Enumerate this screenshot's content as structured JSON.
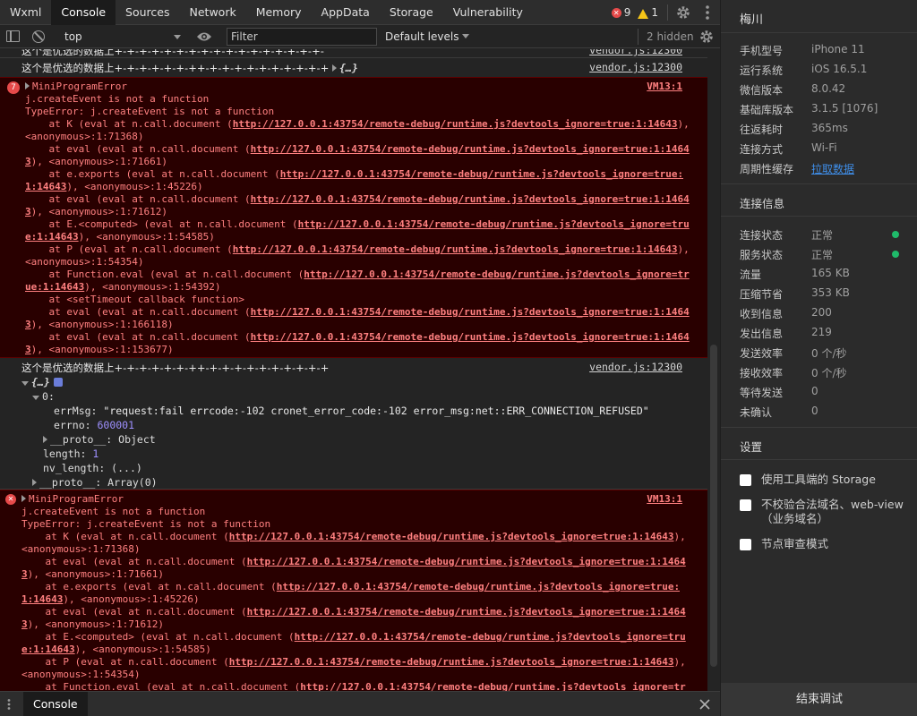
{
  "tabs": [
    {
      "label": "Wxml",
      "active": false
    },
    {
      "label": "Console",
      "active": true
    },
    {
      "label": "Sources",
      "active": false
    },
    {
      "label": "Network",
      "active": false
    },
    {
      "label": "Memory",
      "active": false
    },
    {
      "label": "AppData",
      "active": false
    },
    {
      "label": "Storage",
      "active": false
    },
    {
      "label": "Vulnerability",
      "active": false
    }
  ],
  "counts": {
    "errors": "9",
    "warnings": "1"
  },
  "toolbar": {
    "context": "top",
    "filter_placeholder": "Filter",
    "levels": "Default levels",
    "hidden": "2 hidden"
  },
  "logs": {
    "partial_top": "这个是优选的数据上+-+-+-+-+-+-+-+-+-+-+-+-+-+-+-+-+-",
    "partial_top_src": "vendor.js:12300",
    "row1": {
      "msg": "这个是优选的数据上+-+-+-+-+-+-++-+-+-+-+-+-+-+-+-+-+",
      "preview": "{…}",
      "src": "vendor.js:12300"
    },
    "err1": {
      "count": "7",
      "title": "MiniProgramError",
      "src": "VM13:1",
      "message": "j.createEvent is not a function",
      "type_line": "TypeError: j.createEvent is not a function"
    },
    "row2": {
      "msg": "这个是优选的数据上+-+-+-+-+-+-++-+-+-+-+-+-+-+-+-+-+",
      "src": "vendor.js:12300"
    },
    "obj": {
      "preview": "{…}",
      "index": "0",
      "errMsg_key": "errMsg",
      "errMsg_val": "\"request:fail errcode:-102 cronet_error_code:-102 error_msg:net::ERR_CONNECTION_REFUSED\"",
      "errno_key": "errno",
      "errno_val": "600001",
      "proto_inner": "__proto__: Object",
      "length_key": "length",
      "length_val": "1",
      "nvlen_key": "nv_length",
      "nvlen_val": "(...)",
      "proto_outer": "__proto__: Array(0)"
    },
    "err2": {
      "title": "MiniProgramError",
      "src": "VM13:1",
      "message": "j.createEvent is not a function",
      "type_line": "TypeError: j.createEvent is not a function"
    },
    "stack1": [
      {
        "pre": "    at K (eval at n.call.document (",
        "link": "http://127.0.0.1:43754/remote-debug/runtime.js?devtools_ignore=true:1:14643",
        "post": "),"
      },
      {
        "pre": "<anonymous>:1:71368)",
        "link": "",
        "post": ""
      },
      {
        "pre": "    at eval (eval at n.call.document (",
        "link": "http://127.0.0.1:43754/remote-debug/runtime.js?devtools_ignore=true:1:1464",
        "post": ""
      },
      {
        "pre": "",
        "link": "3",
        "post": "), <anonymous>:1:71661)"
      },
      {
        "pre": "    at e.exports (eval at n.call.document (",
        "link": "http://127.0.0.1:43754/remote-debug/runtime.js?devtools_ignore=true:",
        "post": ""
      },
      {
        "pre": "",
        "link": "1:14643",
        "post": "), <anonymous>:1:45226)"
      },
      {
        "pre": "    at eval (eval at n.call.document (",
        "link": "http://127.0.0.1:43754/remote-debug/runtime.js?devtools_ignore=true:1:1464",
        "post": ""
      },
      {
        "pre": "",
        "link": "3",
        "post": "), <anonymous>:1:71612)"
      },
      {
        "pre": "    at E.<computed> (eval at n.call.document (",
        "link": "http://127.0.0.1:43754/remote-debug/runtime.js?devtools_ignore=tru",
        "post": ""
      },
      {
        "pre": "",
        "link": "e:1:14643",
        "post": "), <anonymous>:1:54585)"
      },
      {
        "pre": "    at P (eval at n.call.document (",
        "link": "http://127.0.0.1:43754/remote-debug/runtime.js?devtools_ignore=true:1:14643",
        "post": "),"
      },
      {
        "pre": "<anonymous>:1:54354)",
        "link": "",
        "post": ""
      },
      {
        "pre": "    at Function.eval (eval at n.call.document (",
        "link": "http://127.0.0.1:43754/remote-debug/runtime.js?devtools_ignore=tr",
        "post": ""
      },
      {
        "pre": "",
        "link": "ue:1:14643",
        "post": "), <anonymous>:1:54392)"
      },
      {
        "pre": "    at <setTimeout callback function>",
        "link": "",
        "post": ""
      },
      {
        "pre": "    at eval (eval at n.call.document (",
        "link": "http://127.0.0.1:43754/remote-debug/runtime.js?devtools_ignore=true:1:1464",
        "post": ""
      },
      {
        "pre": "",
        "link": "3",
        "post": "), <anonymous>:1:166118)"
      },
      {
        "pre": "    at eval (eval at n.call.document (",
        "link": "http://127.0.0.1:43754/remote-debug/runtime.js?devtools_ignore=true:1:1464",
        "post": ""
      },
      {
        "pre": "",
        "link": "3",
        "post": "), <anonymous>:1:153677)"
      }
    ],
    "stack2": [
      {
        "pre": "    at K (eval at n.call.document (",
        "link": "http://127.0.0.1:43754/remote-debug/runtime.js?devtools_ignore=true:1:14643",
        "post": "),"
      },
      {
        "pre": "<anonymous>:1:71368)",
        "link": "",
        "post": ""
      },
      {
        "pre": "    at eval (eval at n.call.document (",
        "link": "http://127.0.0.1:43754/remote-debug/runtime.js?devtools_ignore=true:1:1464",
        "post": ""
      },
      {
        "pre": "",
        "link": "3",
        "post": "), <anonymous>:1:71661)"
      },
      {
        "pre": "    at e.exports (eval at n.call.document (",
        "link": "http://127.0.0.1:43754/remote-debug/runtime.js?devtools_ignore=true:",
        "post": ""
      },
      {
        "pre": "",
        "link": "1:14643",
        "post": "), <anonymous>:1:45226)"
      },
      {
        "pre": "    at eval (eval at n.call.document (",
        "link": "http://127.0.0.1:43754/remote-debug/runtime.js?devtools_ignore=true:1:1464",
        "post": ""
      },
      {
        "pre": "",
        "link": "3",
        "post": "), <anonymous>:1:71612)"
      },
      {
        "pre": "    at E.<computed> (eval at n.call.document (",
        "link": "http://127.0.0.1:43754/remote-debug/runtime.js?devtools_ignore=tru",
        "post": ""
      },
      {
        "pre": "",
        "link": "e:1:14643",
        "post": "), <anonymous>:1:54585)"
      },
      {
        "pre": "    at P (eval at n.call.document (",
        "link": "http://127.0.0.1:43754/remote-debug/runtime.js?devtools_ignore=true:1:14643",
        "post": "),"
      },
      {
        "pre": "<anonymous>:1:54354)",
        "link": "",
        "post": ""
      },
      {
        "pre": "    at Function.eval (eval at n.call.document (",
        "link": "http://127.0.0.1:43754/remote-debug/runtime.js?devtools_ignore=tr",
        "post": ""
      }
    ]
  },
  "drawer": {
    "tab": "Console"
  },
  "info": {
    "device": "梅川",
    "basic": [
      {
        "label": "手机型号",
        "value": "iPhone 11",
        "link": false
      },
      {
        "label": "运行系统",
        "value": "iOS 16.5.1",
        "link": false
      },
      {
        "label": "微信版本",
        "value": "8.0.42",
        "link": false
      },
      {
        "label": "基础库版本",
        "value": "3.1.5 [1076]",
        "link": false
      },
      {
        "label": "往返耗时",
        "value": "365ms",
        "link": false
      },
      {
        "label": "连接方式",
        "value": "Wi-Fi",
        "link": false
      },
      {
        "label": "周期性缓存",
        "value": "拉取数据",
        "link": true
      }
    ],
    "conn_title": "连接信息",
    "conn": [
      {
        "label": "连接状态",
        "value": "正常",
        "dot": true
      },
      {
        "label": "服务状态",
        "value": "正常",
        "dot": true
      },
      {
        "label": "流量",
        "value": "165 KB",
        "dot": false
      },
      {
        "label": "压缩节省",
        "value": "353 KB",
        "dot": false
      },
      {
        "label": "收到信息",
        "value": "200",
        "dot": false
      },
      {
        "label": "发出信息",
        "value": "219",
        "dot": false
      },
      {
        "label": "发送效率",
        "value": "0 个/秒",
        "dot": false
      },
      {
        "label": "接收效率",
        "value": "0 个/秒",
        "dot": false
      },
      {
        "label": "等待发送",
        "value": "0",
        "dot": false
      },
      {
        "label": "未确认",
        "value": "0",
        "dot": false
      }
    ],
    "settings_title": "设置",
    "settings": [
      {
        "label": "使用工具端的 Storage",
        "checked": false
      },
      {
        "label": "不校验合法域名、web-view（业务域名）",
        "checked": false
      },
      {
        "label": "节点审查模式",
        "checked": false
      }
    ],
    "end_button": "结束调试"
  },
  "colors": {
    "status_ok": "#1fba6a",
    "error_bg": "#290000",
    "error_text": "#ff8080",
    "link": "#3f8ee8"
  }
}
